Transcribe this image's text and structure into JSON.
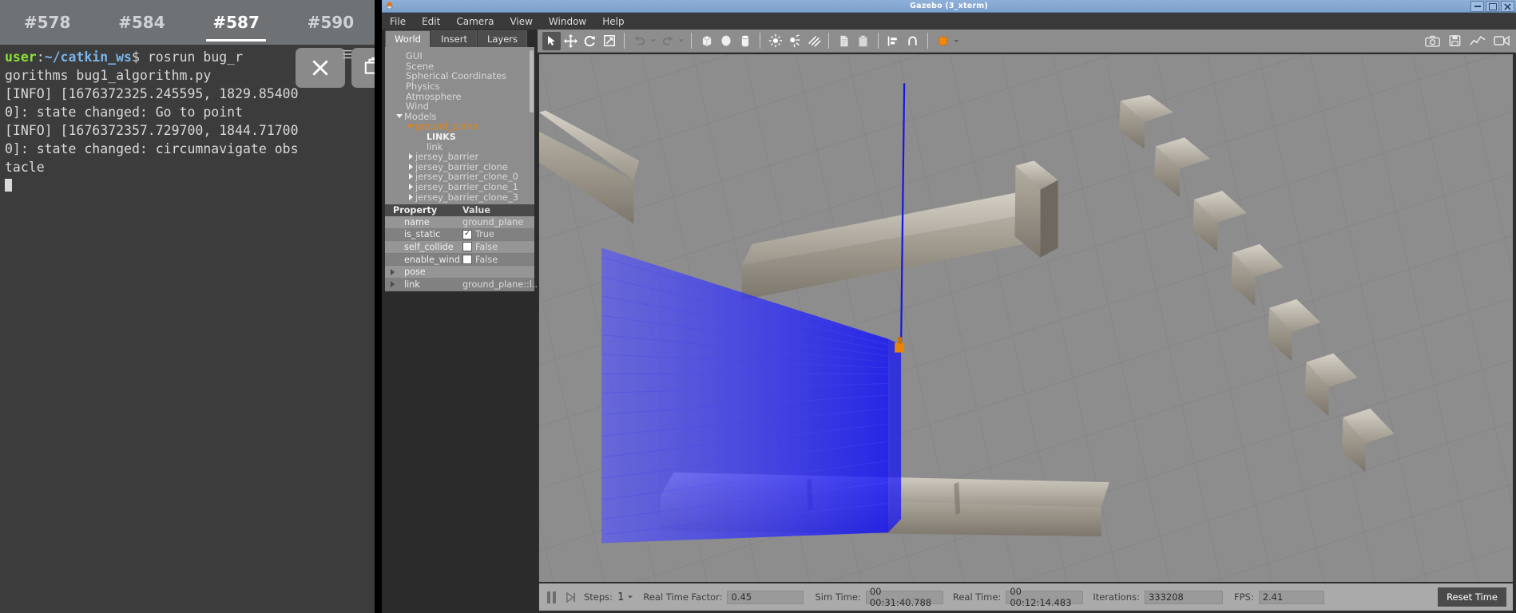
{
  "terminal": {
    "tabs": [
      {
        "label": "#578",
        "active": false
      },
      {
        "label": "#584",
        "active": false
      },
      {
        "label": "#587",
        "active": true
      },
      {
        "label": "#590",
        "active": false
      }
    ],
    "prompt_user": "user",
    "prompt_sep": ":",
    "prompt_path": "~/catkin_ws",
    "prompt_dollar": "$ ",
    "command": "rosrun bug_r",
    "lines": [
      "gorithms bug1_algorithm.py",
      "[INFO] [1676372325.245595, 1829.85400",
      "0]: state changed: Go to point",
      "[INFO] [1676372357.729700, 1844.71700",
      "0]: state changed: circumnavigate obs",
      "tacle"
    ],
    "close_icon": "close-icon",
    "menu_icon": "hamburger-icon",
    "copy_icon": "copy-windows-icon"
  },
  "gazebo": {
    "window_title": "Gazebo (3_xterm)",
    "app_icon": "gazebo-logo-icon",
    "window_buttons": [
      "minimize",
      "maximize",
      "close"
    ],
    "menus": [
      "File",
      "Edit",
      "Camera",
      "View",
      "Window",
      "Help"
    ],
    "panel_tabs": [
      {
        "label": "World",
        "active": true
      },
      {
        "label": "Insert",
        "active": false
      },
      {
        "label": "Layers",
        "active": false
      }
    ],
    "tree": [
      {
        "label": "GUI",
        "indent": 1,
        "twisty": "none",
        "style": "normal"
      },
      {
        "label": "Scene",
        "indent": 1,
        "twisty": "none",
        "style": "normal"
      },
      {
        "label": "Spherical Coordinates",
        "indent": 1,
        "twisty": "none",
        "style": "normal"
      },
      {
        "label": "Physics",
        "indent": 1,
        "twisty": "none",
        "style": "normal"
      },
      {
        "label": "Atmosphere",
        "indent": 1,
        "twisty": "none",
        "style": "normal"
      },
      {
        "label": "Wind",
        "indent": 1,
        "twisty": "none",
        "style": "normal"
      },
      {
        "label": "Models",
        "indent": 0,
        "twisty": "down",
        "style": "normal"
      },
      {
        "label": "ground_plane",
        "indent": 1,
        "twisty": "down",
        "style": "selected"
      },
      {
        "label": "LINKS",
        "indent": 3,
        "twisty": "none",
        "style": "links"
      },
      {
        "label": "link",
        "indent": 3,
        "twisty": "none",
        "style": "normal"
      },
      {
        "label": "jersey_barrier",
        "indent": 1,
        "twisty": "right",
        "style": "normal"
      },
      {
        "label": "jersey_barrier_clone",
        "indent": 1,
        "twisty": "right",
        "style": "normal"
      },
      {
        "label": "jersey_barrier_clone_0",
        "indent": 1,
        "twisty": "right",
        "style": "normal"
      },
      {
        "label": "jersey_barrier_clone_1",
        "indent": 1,
        "twisty": "right",
        "style": "normal"
      },
      {
        "label": "jersey_barrier_clone_3",
        "indent": 1,
        "twisty": "right",
        "style": "normal"
      }
    ],
    "properties": {
      "header": {
        "key": "Property",
        "value": "Value"
      },
      "rows": [
        {
          "key": "name",
          "value": "ground_plane",
          "type": "text",
          "expand": false
        },
        {
          "key": "is_static",
          "value": "True",
          "type": "checkbox",
          "checked": true,
          "expand": false
        },
        {
          "key": "self_collide",
          "value": "False",
          "type": "checkbox",
          "checked": false,
          "expand": false
        },
        {
          "key": "enable_wind",
          "value": "False",
          "type": "checkbox",
          "checked": false,
          "expand": false
        },
        {
          "key": "pose",
          "value": "",
          "type": "text",
          "expand": true
        },
        {
          "key": "link",
          "value": "ground_plane::l...",
          "type": "text",
          "expand": true
        }
      ]
    },
    "toolbar": {
      "items": [
        {
          "name": "select-mode-icon",
          "active": true
        },
        {
          "name": "translate-mode-icon",
          "active": false
        },
        {
          "name": "rotate-mode-icon",
          "active": false
        },
        {
          "name": "scale-mode-icon",
          "active": false
        },
        {
          "name": "undo-icon",
          "active": false
        },
        {
          "name": "undo-dropdown-icon",
          "active": false
        },
        {
          "name": "redo-icon",
          "active": false
        },
        {
          "name": "redo-dropdown-icon",
          "active": false
        },
        {
          "name": "box-shape-icon",
          "active": false
        },
        {
          "name": "sphere-shape-icon",
          "active": false
        },
        {
          "name": "cylinder-shape-icon",
          "active": false
        },
        {
          "name": "point-light-icon",
          "active": false
        },
        {
          "name": "spot-light-icon",
          "active": false
        },
        {
          "name": "directional-light-icon",
          "active": false
        },
        {
          "name": "copy-icon",
          "active": false
        },
        {
          "name": "paste-icon",
          "active": false
        },
        {
          "name": "align-icon",
          "active": false
        },
        {
          "name": "snap-icon",
          "active": false
        },
        {
          "name": "view-angle-icon",
          "active": false
        }
      ],
      "right_items": [
        {
          "name": "screenshot-icon"
        },
        {
          "name": "save-log-icon"
        },
        {
          "name": "plot-icon"
        },
        {
          "name": "record-video-icon"
        }
      ]
    },
    "status": {
      "pause_icon": "pause-icon",
      "step_icon": "step-forward-icon",
      "steps_label": "Steps:",
      "steps_value": "1",
      "rtf_label": "Real Time Factor:",
      "rtf_value": "0.45",
      "sim_time_label": "Sim Time:",
      "sim_time_value": "00 00:31:40.788",
      "real_time_label": "Real Time:",
      "real_time_value": "00 00:12:14.483",
      "iterations_label": "Iterations:",
      "iterations_value": "333208",
      "fps_label": "FPS:",
      "fps_value": "2.41",
      "reset_label": "Reset Time"
    },
    "scene": {
      "laser_color": "#2020f0",
      "laser_ray_color": "#0000cc",
      "robot_color": "#e8830c",
      "ground_color": "#8c8c8c",
      "grid_color": "#7e7e7e",
      "barrier_color": "#b9b2a6"
    }
  }
}
